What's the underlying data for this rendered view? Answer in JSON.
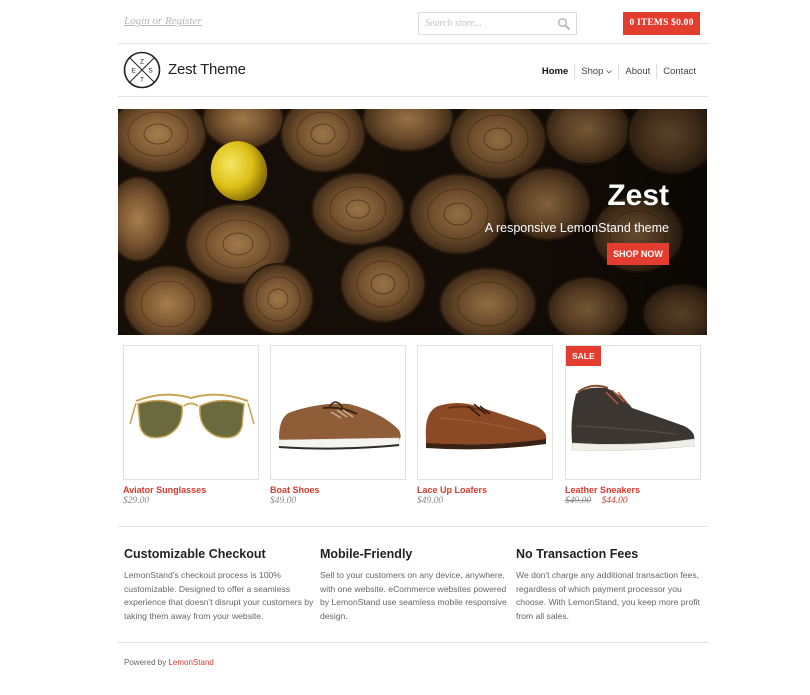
{
  "topbar": {
    "login_label": "Login or Register",
    "search_placeholder": "Search store...",
    "search_icon": "magnifier-icon",
    "cart_label": "0 ITEMS $0.00"
  },
  "header": {
    "logo_letters": [
      "Z",
      "E",
      "S",
      "T"
    ],
    "brand": "Zest Theme",
    "nav": [
      {
        "label": "Home",
        "active": true
      },
      {
        "label": "Shop",
        "dropdown": true
      },
      {
        "label": "About"
      },
      {
        "label": "Contact"
      }
    ]
  },
  "hero": {
    "title": "Zest",
    "subtitle": "A responsive LemonStand theme",
    "button_label": "SHOP NOW",
    "image": "stacked-firewood-logs-with-lemon"
  },
  "products": [
    {
      "name": "Aviator Sunglasses",
      "price": "$29.00",
      "image": "sunglasses"
    },
    {
      "name": "Boat Shoes",
      "price": "$49.00",
      "image": "boat-shoe"
    },
    {
      "name": "Lace Up Loafers",
      "price": "$49.00",
      "image": "loafer"
    },
    {
      "name": "Leather Sneakers",
      "old_price": "$49.00",
      "price": "$44.00",
      "badge": "SALE",
      "image": "sneaker"
    }
  ],
  "features": [
    {
      "title": "Customizable Checkout",
      "text": "LemonStand's checkout process is 100% customizable. Designed to offer a seamless experience that doesn't disrupt your customers by taking them away from your website."
    },
    {
      "title": "Mobile-Friendly",
      "text": "Sell to your customers on any device, anywhere, with one website. eCommerce websites powered by LemonStand use seamless mobile responsive design."
    },
    {
      "title": "No Transaction Fees",
      "text": "We don't charge any additional transaction fees, regardless of which payment processor you choose. With LemonStand, you keep more profit from all sales."
    }
  ],
  "footer": {
    "prefix": "Powered by ",
    "link_label": "LemonStand"
  },
  "colors": {
    "accent": "#e33d2f",
    "link": "#d63a2c",
    "divider": "#e3e3e3"
  }
}
